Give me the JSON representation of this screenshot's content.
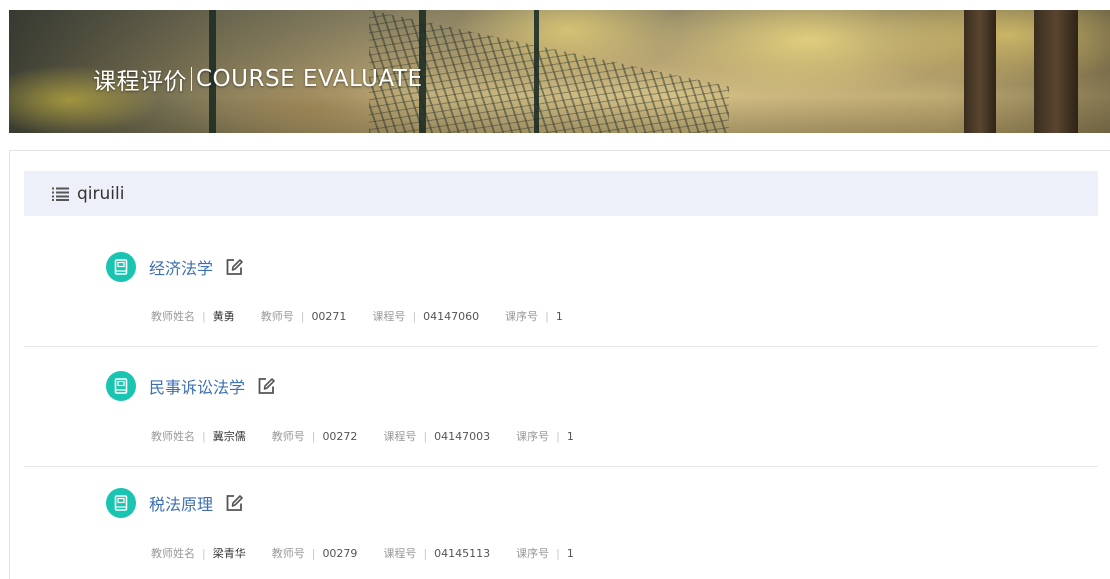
{
  "banner": {
    "title_cn": "课程评价",
    "title_en": "COURSE EVALUATE"
  },
  "user": {
    "name": "qiruili",
    "icon": "list-icon"
  },
  "labels": {
    "teacher_name": "教师姓名",
    "teacher_id": "教师号",
    "course_id": "课程号",
    "section_id": "课序号"
  },
  "courses": [
    {
      "name": "经济法学",
      "teacher_name": "黄勇",
      "teacher_id": "00271",
      "course_id": "04147060",
      "section_id": "1"
    },
    {
      "name": "民事诉讼法学",
      "teacher_name": "冀宗儒",
      "teacher_id": "00272",
      "course_id": "04147003",
      "section_id": "1"
    },
    {
      "name": "税法原理",
      "teacher_name": "梁青华",
      "teacher_id": "00279",
      "course_id": "04145113",
      "section_id": "1"
    }
  ],
  "icons": {
    "course_badge": "book-icon",
    "edit": "edit-icon"
  },
  "colors": {
    "accent_teal": "#19c4b0",
    "link_blue": "#3d6fb4",
    "user_bar_bg": "#eef0f9"
  }
}
